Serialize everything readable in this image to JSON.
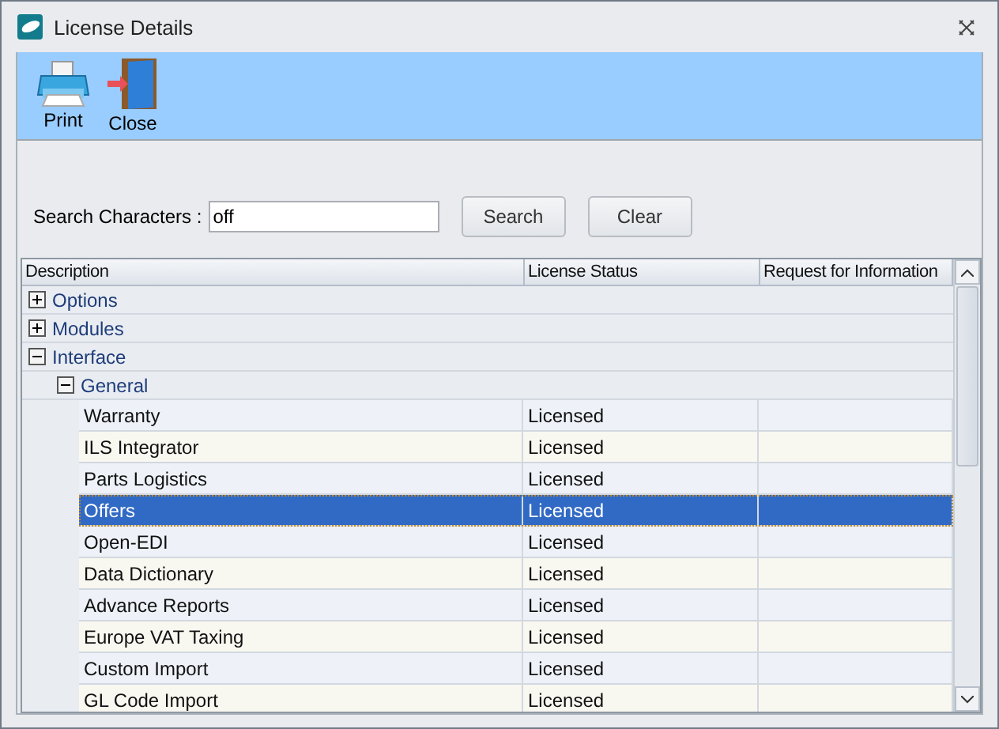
{
  "window": {
    "title": "License Details"
  },
  "toolbar": [
    {
      "label": "Print",
      "kind": "print"
    },
    {
      "label": "Close",
      "kind": "exit"
    }
  ],
  "search": {
    "label": "Search Characters :",
    "value": "off",
    "buttons": [
      "Search",
      "Clear"
    ]
  },
  "grid": {
    "columns": [
      "Description",
      "License Status",
      "Request for Information"
    ],
    "nodes": [
      {
        "label": "Options",
        "expanded": false
      },
      {
        "label": "Modules",
        "expanded": false
      },
      {
        "label": "Interface",
        "expanded": true,
        "children": [
          {
            "label": "General",
            "expanded": true,
            "rows": [
              {
                "cells": [
                  "Warranty",
                  "Licensed"
                ],
                "selected": false
              },
              {
                "cells": [
                  "ILS Integrator",
                  "Licensed"
                ],
                "selected": false
              },
              {
                "cells": [
                  "Parts Logistics",
                  "Licensed"
                ],
                "selected": false
              },
              {
                "cells": [
                  "Offers",
                  "Licensed"
                ],
                "selected": true
              },
              {
                "cells": [
                  "Open-EDI",
                  "Licensed"
                ],
                "selected": false
              },
              {
                "cells": [
                  "Data Dictionary",
                  "Licensed"
                ],
                "selected": false
              },
              {
                "cells": [
                  "Advance Reports",
                  "Licensed"
                ],
                "selected": false
              },
              {
                "cells": [
                  "Europe VAT Taxing",
                  "Licensed"
                ],
                "selected": false
              },
              {
                "cells": [
                  "Custom Import",
                  "Licensed"
                ],
                "selected": false
              },
              {
                "cells": [
                  "GL Code Import",
                  "Licensed"
                ],
                "selected": false
              }
            ]
          }
        ]
      }
    ]
  }
}
